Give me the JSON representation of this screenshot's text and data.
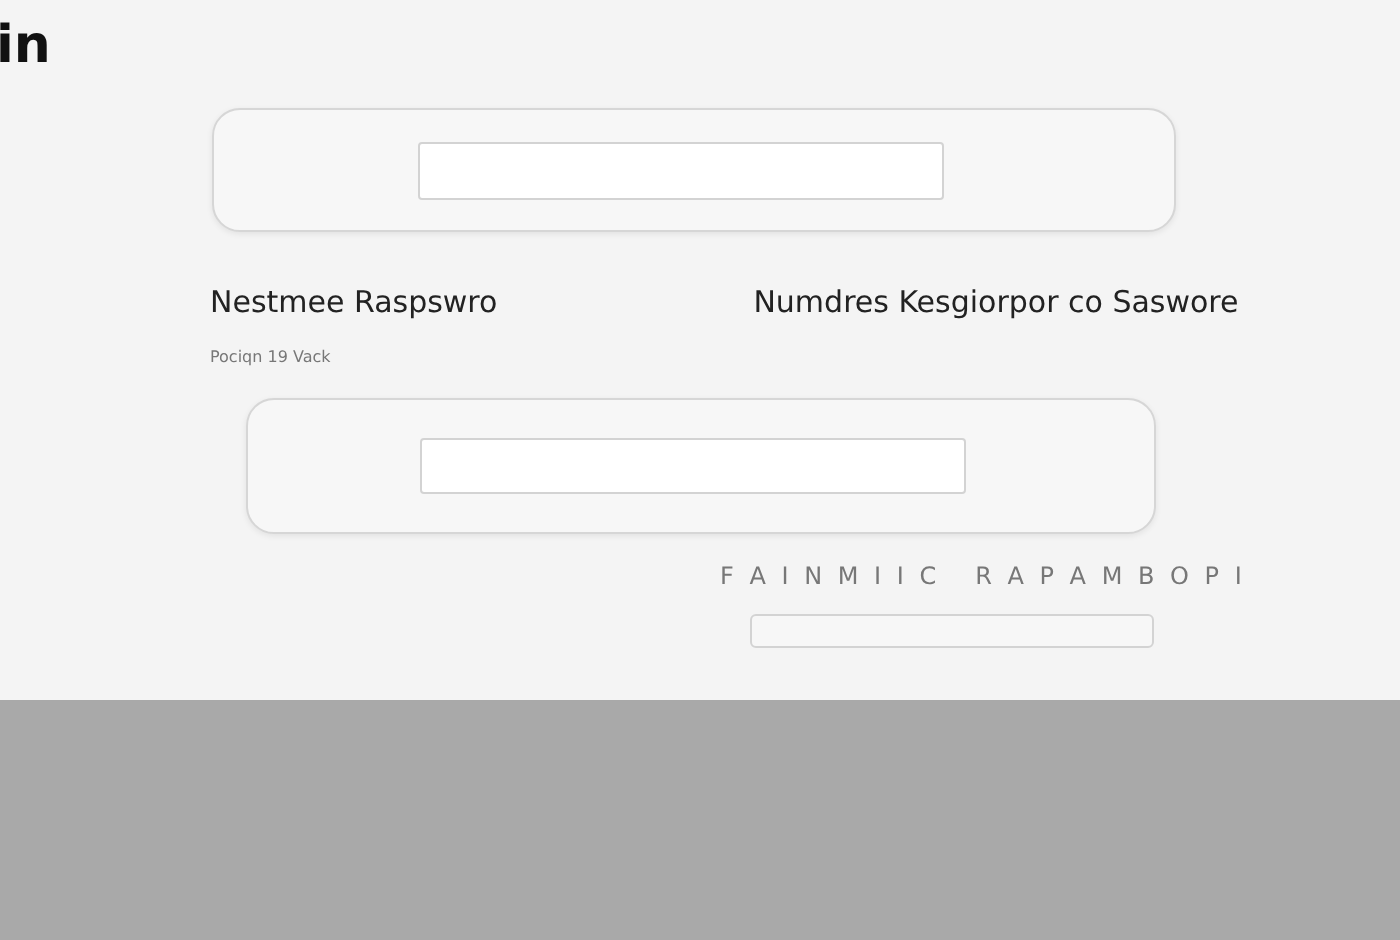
{
  "heading": "in",
  "labels": [
    "Nestmee Raspswro",
    "Numdres Kesgiorpor co Saswore"
  ],
  "hint": "Pociqn 19 Vack",
  "caption": "F A I N M I I C   R A P A M B O P I"
}
